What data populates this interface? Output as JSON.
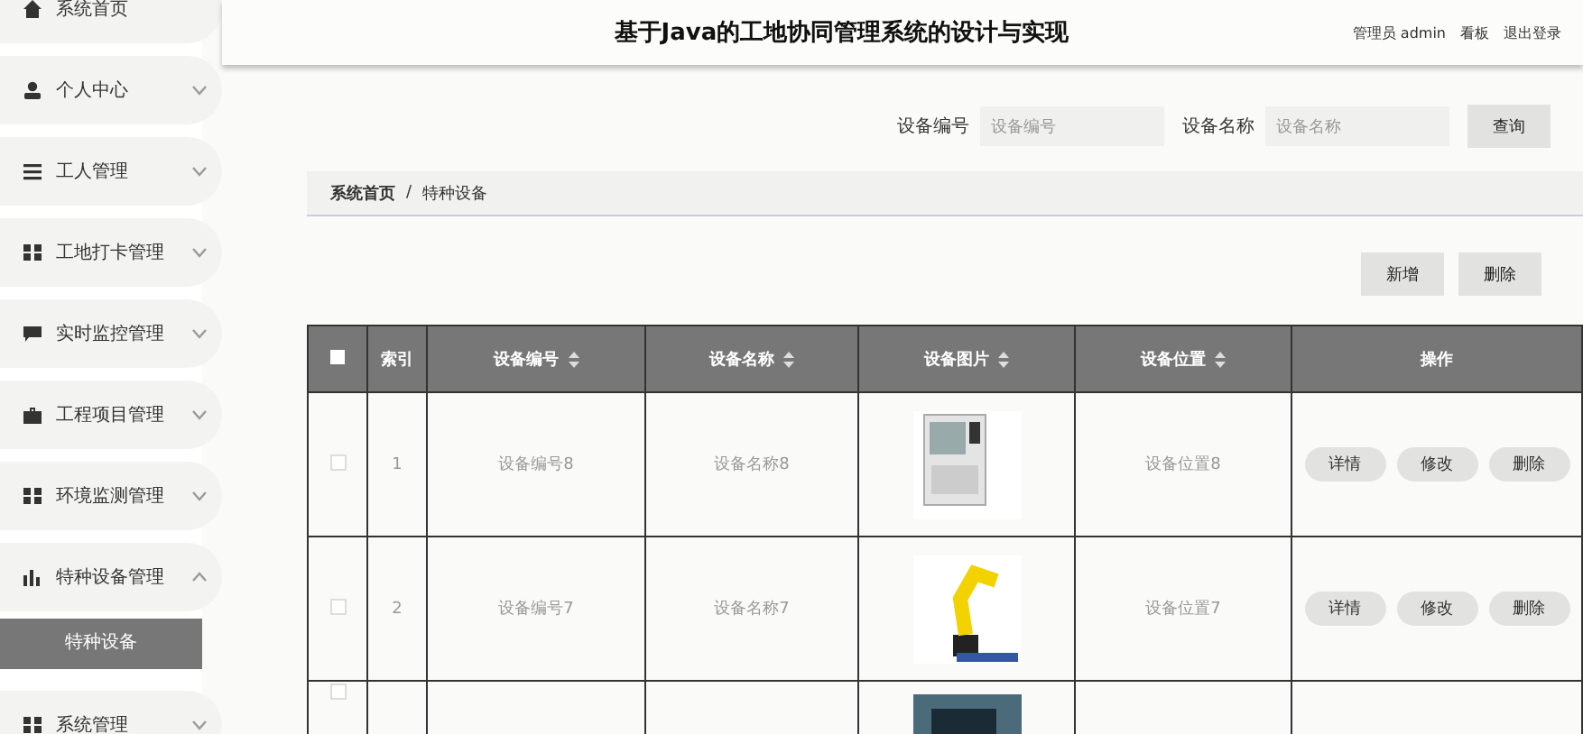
{
  "sidebar": {
    "items": [
      {
        "label": "系统首页"
      },
      {
        "label": "个人中心",
        "expanded": false
      },
      {
        "label": "工人管理",
        "expanded": false
      },
      {
        "label": "工地打卡管理",
        "expanded": false
      },
      {
        "label": "实时监控管理",
        "expanded": false
      },
      {
        "label": "工程项目管理",
        "expanded": false
      },
      {
        "label": "环境监测管理",
        "expanded": false
      },
      {
        "label": "特种设备管理",
        "expanded": true,
        "children": [
          {
            "label": "特种设备",
            "selected": true
          }
        ]
      },
      {
        "label": "系统管理",
        "expanded": false
      }
    ]
  },
  "header": {
    "title": "基于Java的工地协同管理系统的设计与实现",
    "links": [
      "管理员 admin",
      "看板",
      "退出登录"
    ]
  },
  "search": {
    "fields": [
      {
        "label": "设备编号",
        "placeholder": "设备编号"
      },
      {
        "label": "设备名称",
        "placeholder": "设备名称"
      }
    ],
    "button": "查询"
  },
  "breadcrumb": [
    "系统首页",
    "/",
    "特种设备"
  ],
  "actions": [
    "新增",
    "删除"
  ],
  "table": {
    "header_checkbox": {
      "checked": false
    },
    "columns": [
      {
        "label": "索引",
        "sortable": false
      },
      {
        "label": "设备编号",
        "sortable": true
      },
      {
        "label": "设备名称",
        "sortable": true
      },
      {
        "label": "设备图片",
        "sortable": true
      },
      {
        "label": "设备位置",
        "sortable": true
      },
      {
        "label": "操作",
        "sortable": false
      }
    ],
    "rows": [
      {
        "checked": false,
        "index": "1",
        "code": "设备编号8",
        "name": "设备名称8",
        "location": "设备位置8",
        "buttons": [
          "详情",
          "修改",
          "删除"
        ]
      },
      {
        "checked": false,
        "index": "2",
        "code": "设备编号7",
        "name": "设备名称7",
        "location": "设备位置7",
        "buttons": [
          "详情",
          "修改",
          "删除"
        ]
      },
      {
        "checked": false
      }
    ]
  }
}
